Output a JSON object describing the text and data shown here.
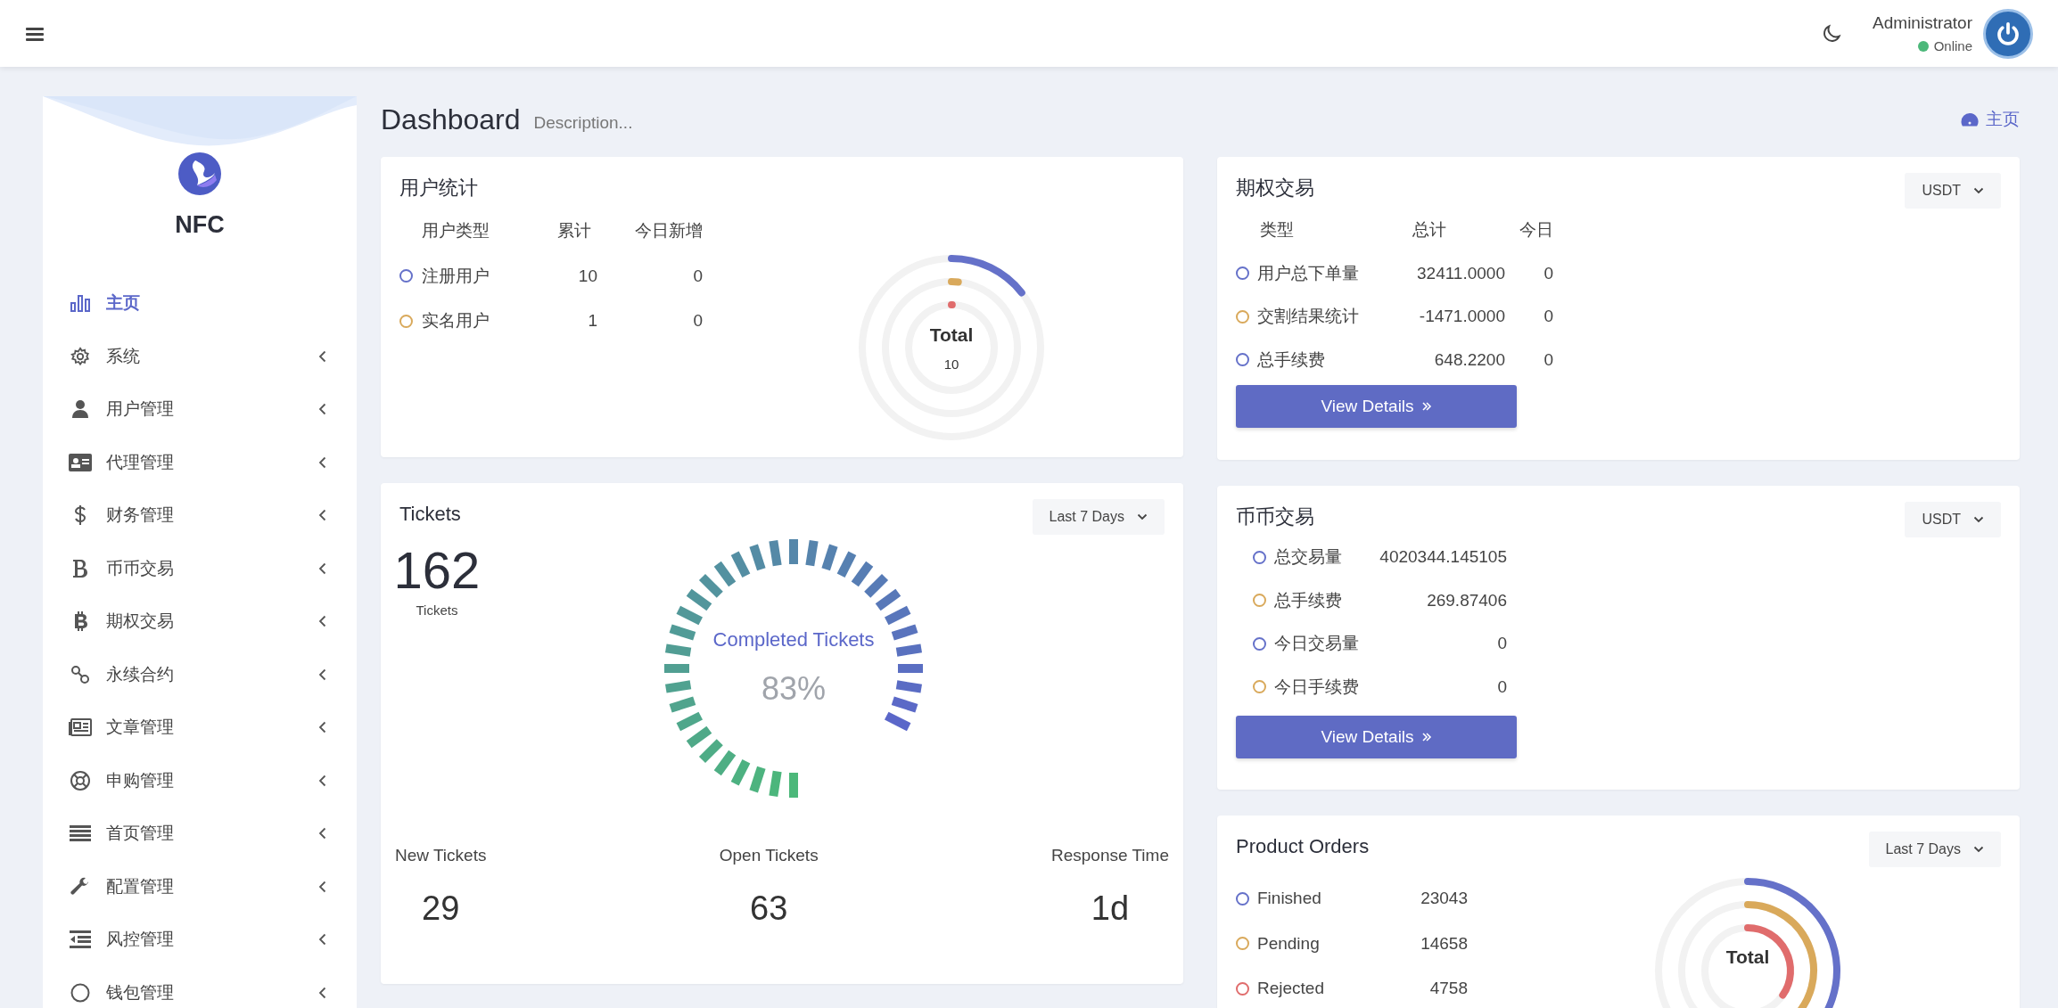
{
  "header": {
    "user_name": "Administrator",
    "status": "Online"
  },
  "sidebar": {
    "brand": "NFC",
    "items": [
      {
        "label": "主页",
        "selected": true,
        "has_submenu": false
      },
      {
        "label": "系统",
        "selected": false,
        "has_submenu": true
      },
      {
        "label": "用户管理",
        "selected": false,
        "has_submenu": true
      },
      {
        "label": "代理管理",
        "selected": false,
        "has_submenu": true
      },
      {
        "label": "财务管理",
        "selected": false,
        "has_submenu": true
      },
      {
        "label": "币币交易",
        "selected": false,
        "has_submenu": true
      },
      {
        "label": "期权交易",
        "selected": false,
        "has_submenu": true
      },
      {
        "label": "永续合约",
        "selected": false,
        "has_submenu": true
      },
      {
        "label": "文章管理",
        "selected": false,
        "has_submenu": true
      },
      {
        "label": "申购管理",
        "selected": false,
        "has_submenu": true
      },
      {
        "label": "首页管理",
        "selected": false,
        "has_submenu": true
      },
      {
        "label": "配置管理",
        "selected": false,
        "has_submenu": true
      },
      {
        "label": "风控管理",
        "selected": false,
        "has_submenu": true
      },
      {
        "label": "钱包管理",
        "selected": false,
        "has_submenu": true
      }
    ]
  },
  "page": {
    "title": "Dashboard",
    "description": "Description...",
    "breadcrumb": "主页"
  },
  "user_stats": {
    "title": "用户统计",
    "columns": [
      "用户类型",
      "累计",
      "今日新增"
    ],
    "rows": [
      {
        "label": "注册用户",
        "total": "10",
        "today": "0",
        "color": "#6571c9"
      },
      {
        "label": "实名用户",
        "total": "1",
        "today": "0",
        "color": "#d9a95b"
      }
    ],
    "chart_center": {
      "label": "Total",
      "value": "10"
    }
  },
  "tickets": {
    "title": "Tickets",
    "range": "Last 7 Days",
    "total": "162",
    "total_label": "Tickets",
    "gauge": {
      "label": "Completed Tickets",
      "value": "83%"
    },
    "stats": [
      {
        "label": "New Tickets",
        "value": "29"
      },
      {
        "label": "Open Tickets",
        "value": "63"
      },
      {
        "label": "Response Time",
        "value": "1d"
      }
    ]
  },
  "options_trading": {
    "title": "期权交易",
    "currency": "USDT",
    "columns": [
      "类型",
      "总计",
      "今日"
    ],
    "rows": [
      {
        "label": "用户总下单量",
        "total": "32411.0000",
        "today": "0",
        "color": "#6571c9"
      },
      {
        "label": "交割结果统计",
        "total": "-1471.0000",
        "today": "0",
        "color": "#d9a95b"
      },
      {
        "label": "总手续费",
        "total": "648.2200",
        "today": "0",
        "color": "#6571c9"
      }
    ],
    "button": "View Details"
  },
  "spot_trading": {
    "title": "币币交易",
    "currency": "USDT",
    "rows": [
      {
        "label": "总交易量",
        "value": "4020344.145105",
        "color": "#6571c9"
      },
      {
        "label": "总手续费",
        "value": "269.87406",
        "color": "#d9a95b"
      },
      {
        "label": "今日交易量",
        "value": "0",
        "color": "#6571c9"
      },
      {
        "label": "今日手续费",
        "value": "0",
        "color": "#d9a95b"
      }
    ],
    "button": "View Details"
  },
  "product_orders": {
    "title": "Product Orders",
    "range": "Last 7 Days",
    "rows": [
      {
        "label": "Finished",
        "value": "23043",
        "color": "#6571c9"
      },
      {
        "label": "Pending",
        "value": "14658",
        "color": "#d9a95b"
      },
      {
        "label": "Rejected",
        "value": "4758",
        "color": "#e06c6c"
      }
    ],
    "chart_center": {
      "label": "Total"
    }
  }
}
